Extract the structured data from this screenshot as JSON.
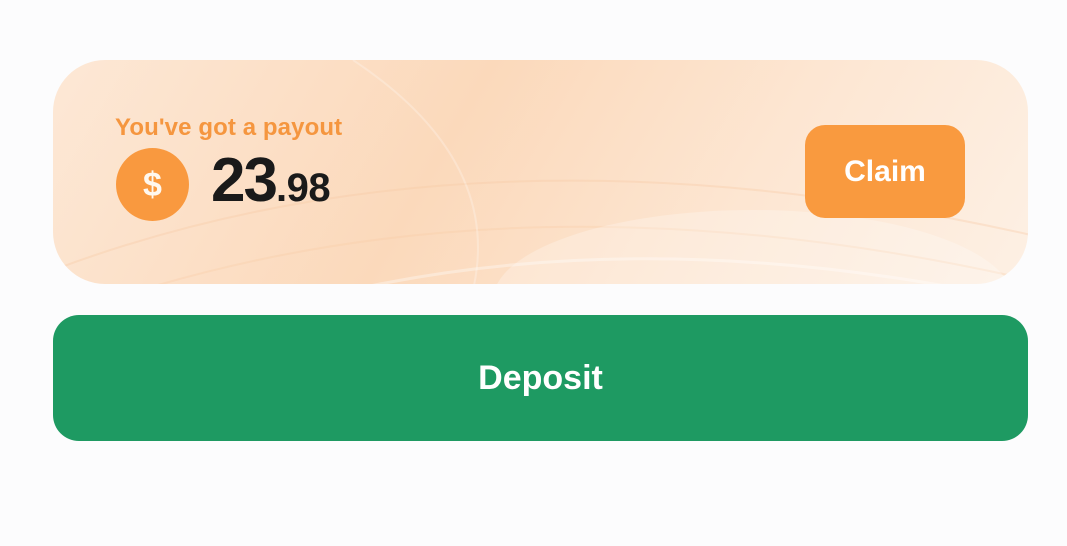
{
  "payout": {
    "label": "You've got a payout",
    "currency_symbol": "$",
    "amount_integer": "23",
    "amount_decimal": ".98",
    "claim_label": "Claim"
  },
  "actions": {
    "deposit_label": "Deposit"
  },
  "colors": {
    "accent_orange": "#f99a3f",
    "deposit_green": "#1e9a62",
    "card_background": "#fbd9bb"
  },
  "icons": {
    "coin": "dollar-coin-icon"
  }
}
